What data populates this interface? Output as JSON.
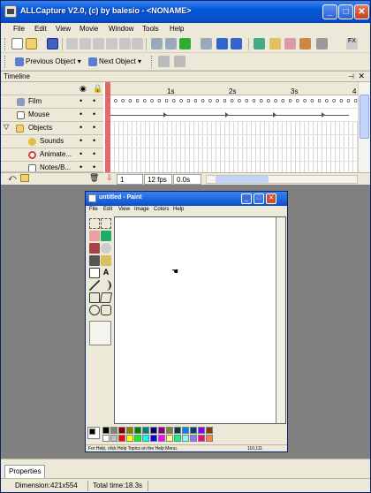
{
  "window": {
    "title": "ALLCapture V2.0, (c) by balesio - <NONAME>"
  },
  "menu": [
    "File",
    "Edit",
    "View",
    "Movie",
    "Window",
    "Tools",
    "Help"
  ],
  "nav": {
    "prev_label": "Previous Object",
    "next_label": "Next Object"
  },
  "timeline": {
    "title": "Timeline",
    "ruler": [
      "1s",
      "2s",
      "3s",
      "4"
    ],
    "layers": [
      {
        "label": "Film",
        "icon": "film-icon"
      },
      {
        "label": "Mouse",
        "icon": "mouse-icon"
      },
      {
        "label": "Objects",
        "icon": "folder-icon"
      },
      {
        "label": "Sounds",
        "icon": "sound-icon"
      },
      {
        "label": "Animate...",
        "icon": "animate-icon"
      },
      {
        "label": "Notes/B...",
        "icon": "notes-icon"
      }
    ],
    "frame": "1",
    "fps": "12 fps",
    "time": "0.0s"
  },
  "paint": {
    "title": "untitled - Paint",
    "menu": [
      "File",
      "Edit",
      "View",
      "Image",
      "Colors",
      "Help"
    ],
    "status_left": "For Help, click Help Topics on the Help Menu.",
    "status_right": "110,111"
  },
  "palette": [
    "#000000",
    "#808080",
    "#800000",
    "#808000",
    "#008000",
    "#008080",
    "#000080",
    "#800080",
    "#808040",
    "#004040",
    "#0080ff",
    "#004080",
    "#8000ff",
    "#804000",
    "#ffffff",
    "#c0c0c0",
    "#ff0000",
    "#ffff00",
    "#00ff00",
    "#00ffff",
    "#0000ff",
    "#ff00ff",
    "#ffff80",
    "#00ff80",
    "#80ffff",
    "#8080ff",
    "#ff0080",
    "#ff8040"
  ],
  "props": {
    "tab": "Properties"
  },
  "status": {
    "dimension": "Dimension:421x554",
    "total": "Total time:18.3s"
  }
}
